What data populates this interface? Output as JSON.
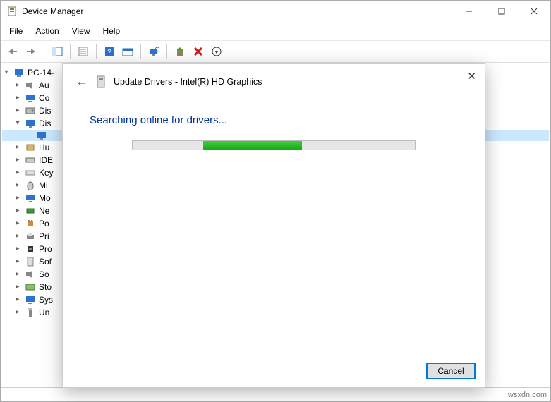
{
  "titlebar": {
    "title": "Device Manager"
  },
  "menu": {
    "file": "File",
    "action": "Action",
    "view": "View",
    "help": "Help"
  },
  "tree": {
    "root": "PC-14-",
    "items": [
      {
        "label": "Au",
        "icon": "audio"
      },
      {
        "label": "Co",
        "icon": "computer"
      },
      {
        "label": "Dis",
        "icon": "disk"
      },
      {
        "label": "Dis",
        "icon": "display",
        "open": true,
        "child": ""
      },
      {
        "label": "Hu",
        "icon": "hid"
      },
      {
        "label": "IDE",
        "icon": "ide"
      },
      {
        "label": "Key",
        "icon": "keyboard"
      },
      {
        "label": "Mi",
        "icon": "mouse"
      },
      {
        "label": "Mo",
        "icon": "monitor"
      },
      {
        "label": "Ne",
        "icon": "network"
      },
      {
        "label": "Po",
        "icon": "port"
      },
      {
        "label": "Pri",
        "icon": "printer"
      },
      {
        "label": "Pro",
        "icon": "processor"
      },
      {
        "label": "Sof",
        "icon": "software"
      },
      {
        "label": "So",
        "icon": "sound"
      },
      {
        "label": "Sto",
        "icon": "storage"
      },
      {
        "label": "Sys",
        "icon": "system"
      },
      {
        "label": "Un",
        "icon": "usb"
      }
    ]
  },
  "dialog": {
    "title": "Update Drivers - Intel(R) HD Graphics",
    "searching": "Searching online for drivers...",
    "progress_left_pct": 25,
    "progress_width_pct": 35,
    "cancel": "Cancel"
  },
  "watermark": "wsxdn.com"
}
